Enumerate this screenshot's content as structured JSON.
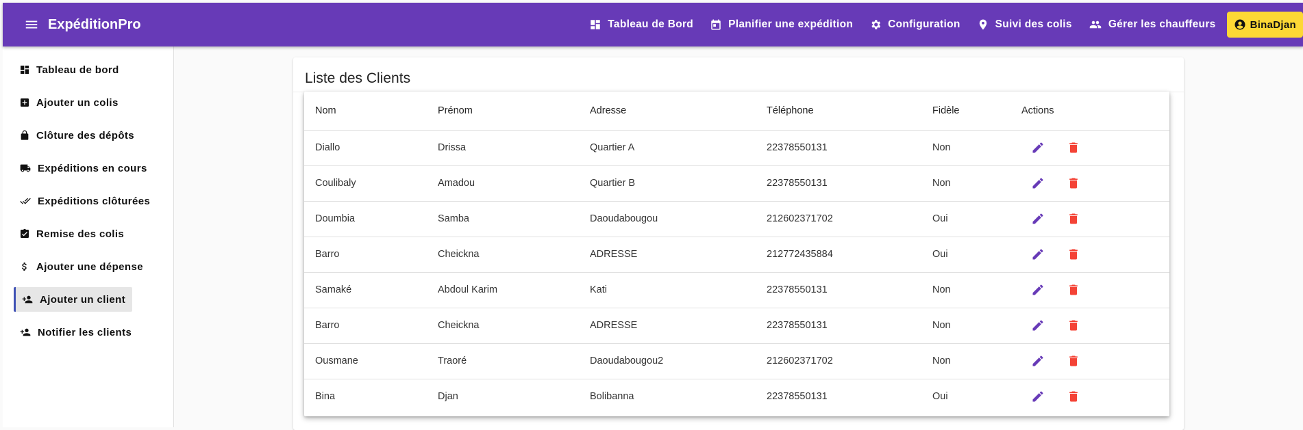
{
  "app": {
    "title": "ExpéditionPro"
  },
  "topnav": {
    "items": [
      {
        "label": "Tableau de Bord",
        "icon": "dashboard-icon"
      },
      {
        "label": "Planifier une expédition",
        "icon": "calendar-icon"
      },
      {
        "label": "Configuration",
        "icon": "gear-icon"
      },
      {
        "label": "Suivi des colis",
        "icon": "location-pin-icon"
      },
      {
        "label": "Gérer les chauffeurs",
        "icon": "people-icon"
      }
    ],
    "user": {
      "label": "BinaDjan",
      "icon": "account-circle-icon"
    }
  },
  "sidebar": {
    "items": [
      {
        "label": "Tableau de bord",
        "icon": "dashboard-icon"
      },
      {
        "label": "Ajouter un colis",
        "icon": "add-box-icon"
      },
      {
        "label": "Clôture des dépôts",
        "icon": "lock-icon"
      },
      {
        "label": "Expéditions en cours",
        "icon": "truck-icon"
      },
      {
        "label": "Expéditions clôturées",
        "icon": "double-check-icon"
      },
      {
        "label": "Remise des colis",
        "icon": "clipboard-check-icon"
      },
      {
        "label": "Ajouter une dépense",
        "icon": "dollar-icon"
      },
      {
        "label": "Ajouter un client",
        "icon": "person-add-icon",
        "active": true
      },
      {
        "label": "Notifier les clients",
        "icon": "person-add-icon"
      }
    ]
  },
  "main": {
    "title": "Liste des Clients",
    "columns": [
      "Nom",
      "Prénom",
      "Adresse",
      "Téléphone",
      "Fidèle",
      "Actions"
    ],
    "rows": [
      {
        "nom": "Diallo",
        "prenom": "Drissa",
        "adresse": "Quartier A",
        "telephone": "22378550131",
        "fidele": "Non"
      },
      {
        "nom": "Coulibaly",
        "prenom": "Amadou",
        "adresse": "Quartier B",
        "telephone": "22378550131",
        "fidele": "Non"
      },
      {
        "nom": "Doumbia",
        "prenom": "Samba",
        "adresse": "Daoudabougou",
        "telephone": "212602371702",
        "fidele": "Oui"
      },
      {
        "nom": "Barro",
        "prenom": "Cheickna",
        "adresse": "ADRESSE",
        "telephone": "212772435884",
        "fidele": "Oui"
      },
      {
        "nom": "Samaké",
        "prenom": "Abdoul Karim",
        "adresse": "Kati",
        "telephone": "22378550131",
        "fidele": "Non"
      },
      {
        "nom": "Barro",
        "prenom": "Cheickna",
        "adresse": "ADRESSE",
        "telephone": "22378550131",
        "fidele": "Non"
      },
      {
        "nom": "Ousmane",
        "prenom": "Traoré",
        "adresse": "Daoudabougou2",
        "telephone": "212602371702",
        "fidele": "Non"
      },
      {
        "nom": "Bina",
        "prenom": "Djan",
        "adresse": "Bolibanna",
        "telephone": "22378550131",
        "fidele": "Oui"
      }
    ],
    "actions": [
      {
        "icon": "edit-icon",
        "color": "#673ab7"
      },
      {
        "icon": "delete-icon",
        "color": "#f44336"
      }
    ]
  },
  "colors": {
    "primary": "#673ab7",
    "accent": "#fdd835",
    "danger": "#f44336"
  }
}
